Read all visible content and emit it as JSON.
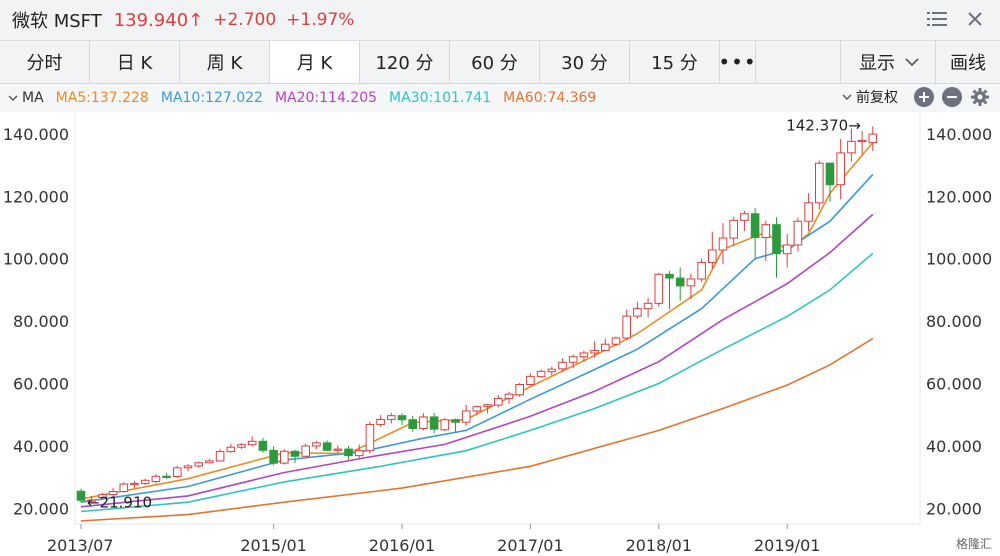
{
  "header": {
    "name": "微软 MSFT",
    "price": "139.940↑",
    "change": "+2.700",
    "change_pct": "+1.97%"
  },
  "tabs": [
    "分时",
    "日 K",
    "周 K",
    "月 K",
    "120 分",
    "60 分",
    "30 分",
    "15 分"
  ],
  "active_tab": 3,
  "more_label": "•••",
  "show_label": "显示",
  "draw_label": "画线",
  "ma_bar": {
    "label": "MA",
    "ma5": "MA5:137.228",
    "ma10": "MA10:127.022",
    "ma20": "MA20:114.205",
    "ma30": "MA30:101.741",
    "ma60": "MA60:74.369",
    "adjust_label": "前复权"
  },
  "watermark": "格隆汇",
  "colors": {
    "up": "#e23d3d",
    "down": "#2e9a3e",
    "ma5": "#f08a24",
    "ma10": "#3c9ad8",
    "ma20": "#b444c0",
    "ma30": "#2ec4c4",
    "ma60": "#e4742e"
  },
  "chart_data": {
    "type": "candlestick",
    "ylim": [
      15,
      147
    ],
    "y_ticks": [
      "140.000",
      "120.000",
      "100.000",
      "80.000",
      "60.000",
      "40.000",
      "20.000"
    ],
    "y_tick_values": [
      140,
      120,
      100,
      80,
      60,
      40,
      20
    ],
    "x_labels": [
      "2013/07",
      "2015/01",
      "2016/01",
      "2017/01",
      "2018/01",
      "2019/01"
    ],
    "x_label_index": [
      0,
      18,
      30,
      42,
      54,
      66
    ],
    "annotation_high": "142.370→",
    "annotation_high_value": 142.37,
    "annotation_low": "←21.910",
    "annotation_low_value": 21.91,
    "candles": [
      [
        25.5,
        22.6,
        26.3,
        21.9
      ],
      [
        22.6,
        22.7,
        24.0,
        22.0
      ],
      [
        23.5,
        24.4,
        25.0,
        22.8
      ],
      [
        24.4,
        25.4,
        26.6,
        23.8
      ],
      [
        25.4,
        27.8,
        28.4,
        25.0
      ],
      [
        27.8,
        28.0,
        28.8,
        26.5
      ],
      [
        28.0,
        29.0,
        29.5,
        27.5
      ],
      [
        28.6,
        30.3,
        31.0,
        28.0
      ],
      [
        30.3,
        30.0,
        31.4,
        29.5
      ],
      [
        30.2,
        33.0,
        33.7,
        29.8
      ],
      [
        33.0,
        33.6,
        34.2,
        31.9
      ],
      [
        33.6,
        34.6,
        35.0,
        33.0
      ],
      [
        34.6,
        35.2,
        35.8,
        34.4
      ],
      [
        35.2,
        38.2,
        39.0,
        35.0
      ],
      [
        38.2,
        39.6,
        40.6,
        37.8
      ],
      [
        39.6,
        40.4,
        41.0,
        39.0
      ],
      [
        40.4,
        41.5,
        43.0,
        39.8
      ],
      [
        41.5,
        38.6,
        42.6,
        37.8
      ],
      [
        38.6,
        34.5,
        40.0,
        33.8
      ],
      [
        34.5,
        38.3,
        39.0,
        34.0
      ],
      [
        38.3,
        36.7,
        38.8,
        34.5
      ],
      [
        36.7,
        40.0,
        40.8,
        36.2
      ],
      [
        40.0,
        41.0,
        41.6,
        39.0
      ],
      [
        41.0,
        38.6,
        41.8,
        38.3
      ],
      [
        38.6,
        39.0,
        40.2,
        37.8
      ],
      [
        39.0,
        36.9,
        40.0,
        35.6
      ],
      [
        36.9,
        38.5,
        40.5,
        36.0
      ],
      [
        38.5,
        46.9,
        47.8,
        37.5
      ],
      [
        46.9,
        48.5,
        49.9,
        46.2
      ],
      [
        48.5,
        49.7,
        50.6,
        47.2
      ],
      [
        49.7,
        48.4,
        50.5,
        46.6
      ],
      [
        48.4,
        45.6,
        49.7,
        44.6
      ],
      [
        45.6,
        49.3,
        50.5,
        45.0
      ],
      [
        49.3,
        45.4,
        50.6,
        44.0
      ],
      [
        45.2,
        48.4,
        48.9,
        44.8
      ],
      [
        48.4,
        47.6,
        48.8,
        44.5
      ],
      [
        47.6,
        51.2,
        53.2,
        46.5
      ],
      [
        51.2,
        52.6,
        52.9,
        49.9
      ],
      [
        52.6,
        53.2,
        53.5,
        50.4
      ],
      [
        53.1,
        55.2,
        56.3,
        52.4
      ],
      [
        55.2,
        56.6,
        57.4,
        53.5
      ],
      [
        56.4,
        59.7,
        60.2,
        55.7
      ],
      [
        59.7,
        62.3,
        63.3,
        59.4
      ],
      [
        62.2,
        63.9,
        64.5,
        61.8
      ],
      [
        63.8,
        64.6,
        65.4,
        62.6
      ],
      [
        64.7,
        66.8,
        68.0,
        63.9
      ],
      [
        66.8,
        68.6,
        69.3,
        64.9
      ],
      [
        68.6,
        69.8,
        70.6,
        67.0
      ],
      [
        69.8,
        70.6,
        73.5,
        68.3
      ],
      [
        70.6,
        72.6,
        74.4,
        71.0
      ],
      [
        72.6,
        74.6,
        75.0,
        72.0
      ],
      [
        74.6,
        81.6,
        83.7,
        74.1
      ],
      [
        81.6,
        84.0,
        86.2,
        80.8
      ],
      [
        84.0,
        85.7,
        87.5,
        81.2
      ],
      [
        85.7,
        95.0,
        95.5,
        84.6
      ],
      [
        95.0,
        93.8,
        96.0,
        83.8
      ],
      [
        93.8,
        91.3,
        97.2,
        86.5
      ],
      [
        91.3,
        93.5,
        95.2,
        87.1
      ],
      [
        93.5,
        98.8,
        100.0,
        92.5
      ],
      [
        98.8,
        102.8,
        108.6,
        96.9
      ],
      [
        102.8,
        106.6,
        111.4,
        98.2
      ],
      [
        106.6,
        112.3,
        113.4,
        104.1
      ],
      [
        112.3,
        114.4,
        115.3,
        108.9
      ],
      [
        114.4,
        106.8,
        116.2,
        100.1
      ],
      [
        106.8,
        110.9,
        112.2,
        99.3
      ],
      [
        110.9,
        101.6,
        113.3,
        93.9
      ],
      [
        101.6,
        104.4,
        107.9,
        97.2
      ],
      [
        104.4,
        112.0,
        113.2,
        102.3
      ],
      [
        112.0,
        117.9,
        121.0,
        108.8
      ],
      [
        117.9,
        130.6,
        131.4,
        115.8
      ],
      [
        130.6,
        123.7,
        130.7,
        118.2
      ],
      [
        123.7,
        133.9,
        138.4,
        119.0
      ],
      [
        133.9,
        137.6,
        141.7,
        131.1
      ],
      [
        137.6,
        137.9,
        140.9,
        133.4
      ],
      [
        137.2,
        139.9,
        142.4,
        134.5
      ]
    ],
    "ma_series": [
      {
        "name": "MA5",
        "values": [
          [
            0,
            23.0
          ],
          [
            10,
            29.5
          ],
          [
            19,
            37.8
          ],
          [
            25,
            37.6
          ],
          [
            31,
            47.5
          ],
          [
            36,
            48.5
          ],
          [
            42,
            59.0
          ],
          [
            48,
            69.0
          ],
          [
            52,
            76.0
          ],
          [
            58,
            90.0
          ],
          [
            60,
            103.0
          ],
          [
            64,
            108.5
          ],
          [
            66,
            102.5
          ],
          [
            68,
            108.0
          ],
          [
            70,
            121.0
          ],
          [
            74,
            137.2
          ]
        ]
      },
      {
        "name": "MA10",
        "values": [
          [
            0,
            22.0
          ],
          [
            10,
            27.0
          ],
          [
            19,
            35.5
          ],
          [
            26,
            38.0
          ],
          [
            32,
            42.5
          ],
          [
            36,
            45.0
          ],
          [
            42,
            55.0
          ],
          [
            48,
            64.5
          ],
          [
            52,
            71.0
          ],
          [
            58,
            84.0
          ],
          [
            63,
            100.0
          ],
          [
            66,
            103.0
          ],
          [
            70,
            112.0
          ],
          [
            74,
            127.0
          ]
        ]
      },
      {
        "name": "MA20",
        "values": [
          [
            0,
            20.5
          ],
          [
            10,
            24.0
          ],
          [
            19,
            31.5
          ],
          [
            27,
            36.5
          ],
          [
            34,
            40.5
          ],
          [
            38,
            45.0
          ],
          [
            42,
            49.5
          ],
          [
            48,
            57.5
          ],
          [
            54,
            67.0
          ],
          [
            60,
            80.5
          ],
          [
            66,
            92.0
          ],
          [
            70,
            102.0
          ],
          [
            74,
            114.2
          ]
        ]
      },
      {
        "name": "MA30",
        "values": [
          [
            0,
            19.0
          ],
          [
            10,
            22.0
          ],
          [
            19,
            28.5
          ],
          [
            28,
            33.5
          ],
          [
            36,
            38.5
          ],
          [
            42,
            45.0
          ],
          [
            48,
            52.0
          ],
          [
            54,
            60.0
          ],
          [
            60,
            71.0
          ],
          [
            66,
            81.5
          ],
          [
            70,
            90.0
          ],
          [
            74,
            101.7
          ]
        ]
      },
      {
        "name": "MA60",
        "values": [
          [
            0,
            16.0
          ],
          [
            10,
            18.0
          ],
          [
            19,
            22.0
          ],
          [
            30,
            26.5
          ],
          [
            42,
            33.5
          ],
          [
            54,
            45.0
          ],
          [
            60,
            52.0
          ],
          [
            66,
            59.5
          ],
          [
            70,
            66.0
          ],
          [
            74,
            74.4
          ]
        ]
      }
    ]
  }
}
